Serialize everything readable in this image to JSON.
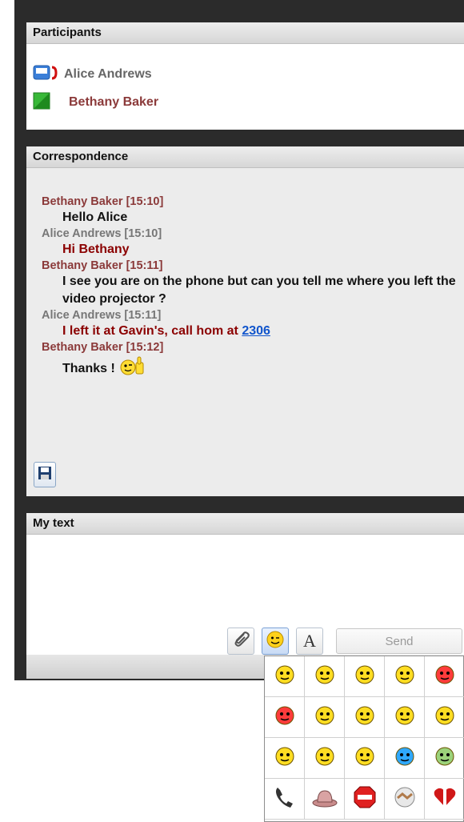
{
  "participants": {
    "title": "Participants",
    "list": [
      {
        "name": "Alice Andrews",
        "status_icon": "phone-on-call-icon"
      },
      {
        "name": "Bethany Baker",
        "status_icon": "available-status-icon"
      }
    ]
  },
  "correspondence": {
    "title": "Correspondence",
    "messages": [
      {
        "author": "Bethany Baker [15:10]",
        "text": "Hello Alice"
      },
      {
        "author": "Alice Andrews [15:10]",
        "text": "Hi Bethany"
      },
      {
        "author": "Bethany Baker [15:11]",
        "text": "I see you are on the phone but can you tell me where you left the video projector ?"
      },
      {
        "author": "Alice Andrews [15:11]",
        "text_before": "I left it at Gavin's, call hom at ",
        "link": "2306"
      },
      {
        "author": "Bethany Baker [15:12]",
        "text": "Thanks !",
        "emoticon": "thumbs-up-smiley-icon"
      }
    ],
    "save_icon": "floppy-disk-icon"
  },
  "my_text": {
    "title": "My text",
    "input_value": "",
    "attach_icon": "paperclip-icon",
    "emoticon_icon": "smiley-icon",
    "font_button_label": "A",
    "send_label": "Send"
  },
  "emoticons": [
    "smile",
    "sad",
    "confused",
    "surprised",
    "angry",
    "swearing",
    "help",
    "music",
    "thumbs-up",
    "cool-drink",
    "birthday",
    "tongue",
    "sleepy",
    "flower",
    "sick",
    "phone",
    "hat",
    "stop",
    "handshake",
    "heart"
  ],
  "colors": {
    "bethany": "#8b3a3a",
    "alice": "#777777",
    "alice_message": "#8b0000",
    "frame": "#2b2b2b",
    "link": "#1155cc"
  }
}
